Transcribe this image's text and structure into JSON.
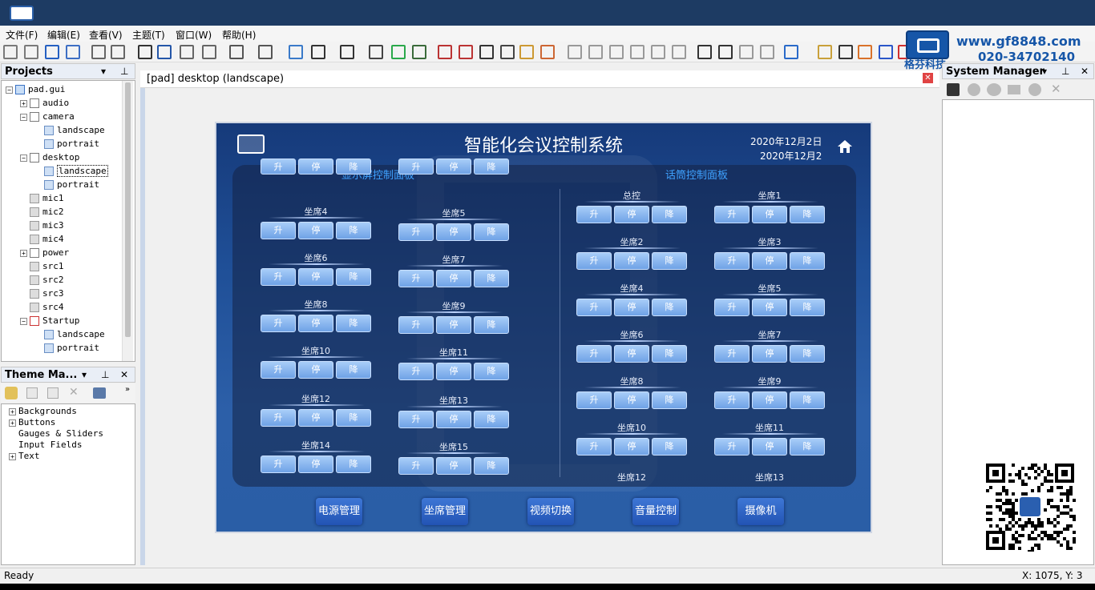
{
  "menu": [
    "文件(F)",
    "编辑(E)",
    "查看(V)",
    "主题(T)",
    "窗口(W)",
    "帮助(H)"
  ],
  "brand": {
    "url": "www.gf8848.com",
    "tel": "020-34702140",
    "name": "格芬科技"
  },
  "projects": {
    "title": "Projects",
    "tree": [
      {
        "label": "pad.gui",
        "ind": 0,
        "pm": "−",
        "ico": "x"
      },
      {
        "label": "audio",
        "ind": 1,
        "pm": "+",
        "ico": "p"
      },
      {
        "label": "camera",
        "ind": 1,
        "pm": "−",
        "ico": "p"
      },
      {
        "label": "landscape",
        "ind": 2,
        "pm": "",
        "ico": "l"
      },
      {
        "label": "portrait",
        "ind": 2,
        "pm": "",
        "ico": "l"
      },
      {
        "label": "desktop",
        "ind": 1,
        "pm": "−",
        "ico": "p"
      },
      {
        "label": "landscape",
        "ind": 2,
        "pm": "",
        "ico": "l",
        "sel": true
      },
      {
        "label": "portrait",
        "ind": 2,
        "pm": "",
        "ico": "l"
      },
      {
        "label": "mic1",
        "ind": 1,
        "pm": "",
        "ico": "s"
      },
      {
        "label": "mic2",
        "ind": 1,
        "pm": "",
        "ico": "s"
      },
      {
        "label": "mic3",
        "ind": 1,
        "pm": "",
        "ico": "s"
      },
      {
        "label": "mic4",
        "ind": 1,
        "pm": "",
        "ico": "s"
      },
      {
        "label": "power",
        "ind": 1,
        "pm": "+",
        "ico": "p"
      },
      {
        "label": "src1",
        "ind": 1,
        "pm": "",
        "ico": "s"
      },
      {
        "label": "src2",
        "ind": 1,
        "pm": "",
        "ico": "s"
      },
      {
        "label": "src3",
        "ind": 1,
        "pm": "",
        "ico": "s"
      },
      {
        "label": "src4",
        "ind": 1,
        "pm": "",
        "ico": "s"
      },
      {
        "label": "Startup",
        "ind": 1,
        "pm": "−",
        "ico": "r"
      },
      {
        "label": "landscape",
        "ind": 2,
        "pm": "",
        "ico": "l"
      },
      {
        "label": "portrait",
        "ind": 2,
        "pm": "",
        "ico": "l"
      }
    ]
  },
  "theme": {
    "title": "Theme Ma...",
    "items": [
      {
        "label": "Backgrounds",
        "pm": "+"
      },
      {
        "label": "Buttons",
        "pm": "+"
      },
      {
        "label": "Gauges & Sliders",
        "pm": ""
      },
      {
        "label": "Input Fields",
        "pm": ""
      },
      {
        "label": "Text",
        "pm": "+"
      }
    ]
  },
  "doc_tab": "[pad] desktop (landscape)",
  "system_manager": "System Manager",
  "hmi": {
    "title": "智能化会议控制系统",
    "date1": "2020年12月2日",
    "date2": "2020年12月2",
    "left_title": "显示屏控制面板",
    "right_title": "话筒控制面板",
    "btn_up": "升",
    "btn_stop": "停",
    "btn_down": "降",
    "left_groups": [
      "坐席4",
      "坐席5",
      "坐席6",
      "坐席7",
      "坐席8",
      "坐席9",
      "坐席10",
      "坐席11",
      "坐席12",
      "坐席13",
      "坐席14",
      "坐席15"
    ],
    "right_groups": [
      "总控",
      "坐席1",
      "坐席2",
      "坐席3",
      "坐席4",
      "坐席5",
      "坐席6",
      "坐席7",
      "坐席8",
      "坐席9",
      "坐席10",
      "坐席11",
      "坐席12",
      "坐席13"
    ],
    "nav": [
      "电源管理",
      "坐席管理",
      "视频切换",
      "音量控制",
      "摄像机"
    ]
  },
  "status": {
    "left": "Ready",
    "right": "X: 1075, Y: 3"
  }
}
